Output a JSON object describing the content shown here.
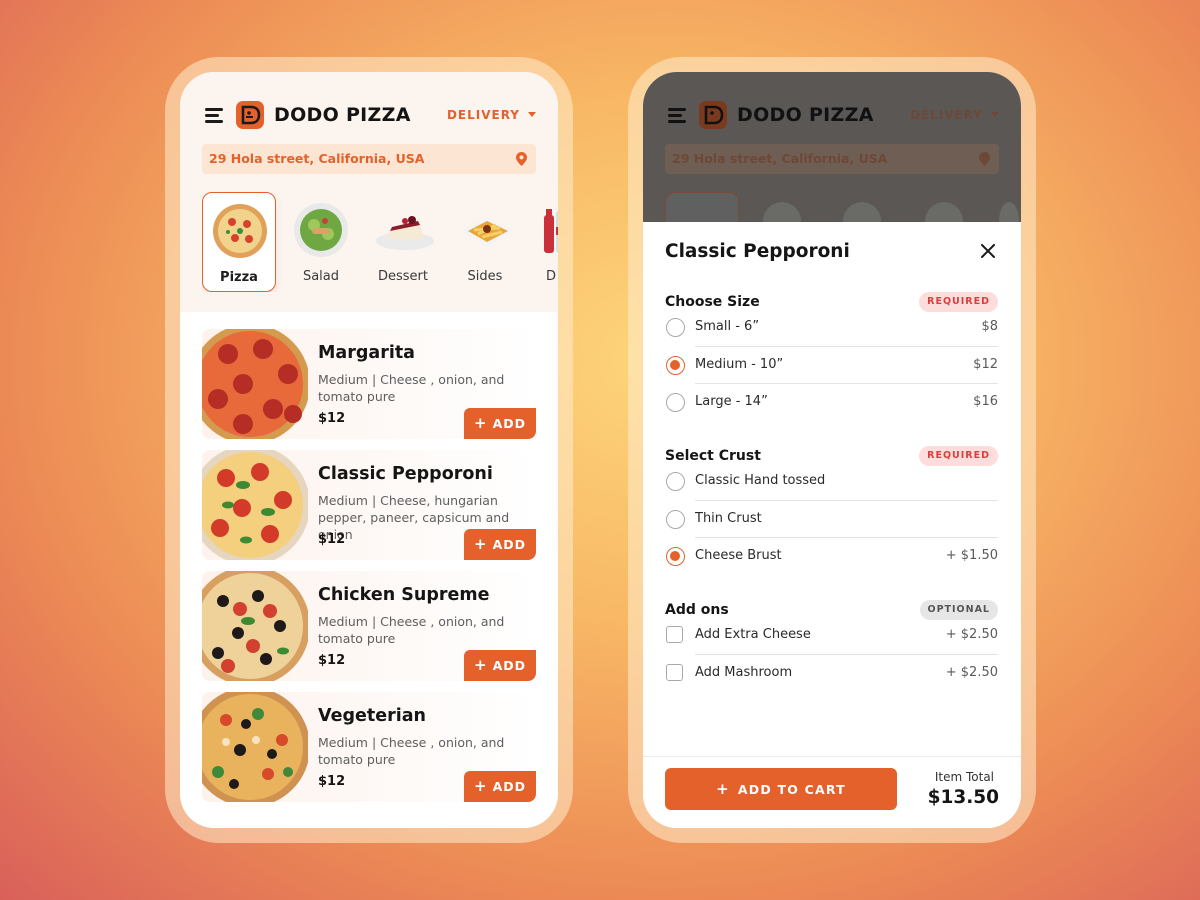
{
  "app": {
    "brand": "DODO PIZZA",
    "delivery_label": "DELIVERY",
    "address": "29 Hola street, California, USA",
    "accent_color": "#e4612c"
  },
  "categories": [
    {
      "label": "Pizza",
      "icon": "pizza-icon",
      "active": true
    },
    {
      "label": "Salad",
      "icon": "salad-icon",
      "active": false
    },
    {
      "label": "Dessert",
      "icon": "cake-icon",
      "active": false
    },
    {
      "label": "Sides",
      "icon": "fries-icon",
      "active": false
    },
    {
      "label": "D",
      "icon": "drinks-icon",
      "active": false
    }
  ],
  "products": [
    {
      "name": "Margarita",
      "desc": "Medium | Cheese , onion, and tomato pure",
      "price": "$12",
      "add_label": "ADD"
    },
    {
      "name": "Classic Pepporoni",
      "desc": "Medium | Cheese, hungarian pepper, paneer, capsicum and onion",
      "price": "$12",
      "add_label": "ADD"
    },
    {
      "name": "Chicken Supreme",
      "desc": "Medium | Cheese , onion, and tomato pure",
      "price": "$12",
      "add_label": "ADD"
    },
    {
      "name": "Vegeterian",
      "desc": "Medium | Cheese , onion, and tomato pure",
      "price": "$12",
      "add_label": "ADD"
    }
  ],
  "sheet": {
    "title": "Classic Pepporoni",
    "sections": [
      {
        "title": "Choose Size",
        "tag": "REQUIRED",
        "type": "radio",
        "options": [
          {
            "label": "Small - 6”",
            "price": "$8",
            "selected": false
          },
          {
            "label": "Medium - 10”",
            "price": "$12",
            "selected": true
          },
          {
            "label": "Large - 14”",
            "price": "$16",
            "selected": false
          }
        ]
      },
      {
        "title": "Select Crust",
        "tag": "REQUIRED",
        "type": "radio",
        "options": [
          {
            "label": "Classic Hand tossed",
            "price": "",
            "selected": false
          },
          {
            "label": "Thin Crust",
            "price": "",
            "selected": false
          },
          {
            "label": "Cheese Brust",
            "price": "+ $1.50",
            "selected": true
          }
        ]
      },
      {
        "title": "Add ons",
        "tag": "OPTIONAL",
        "type": "checkbox",
        "options": [
          {
            "label": "Add Extra Cheese",
            "price": "+ $2.50",
            "selected": false
          },
          {
            "label": "Add Mashroom",
            "price": "+ $2.50",
            "selected": false
          }
        ]
      }
    ],
    "cart_button": "ADD TO CART",
    "total_label": "Item Total",
    "total_value": "$13.50"
  }
}
